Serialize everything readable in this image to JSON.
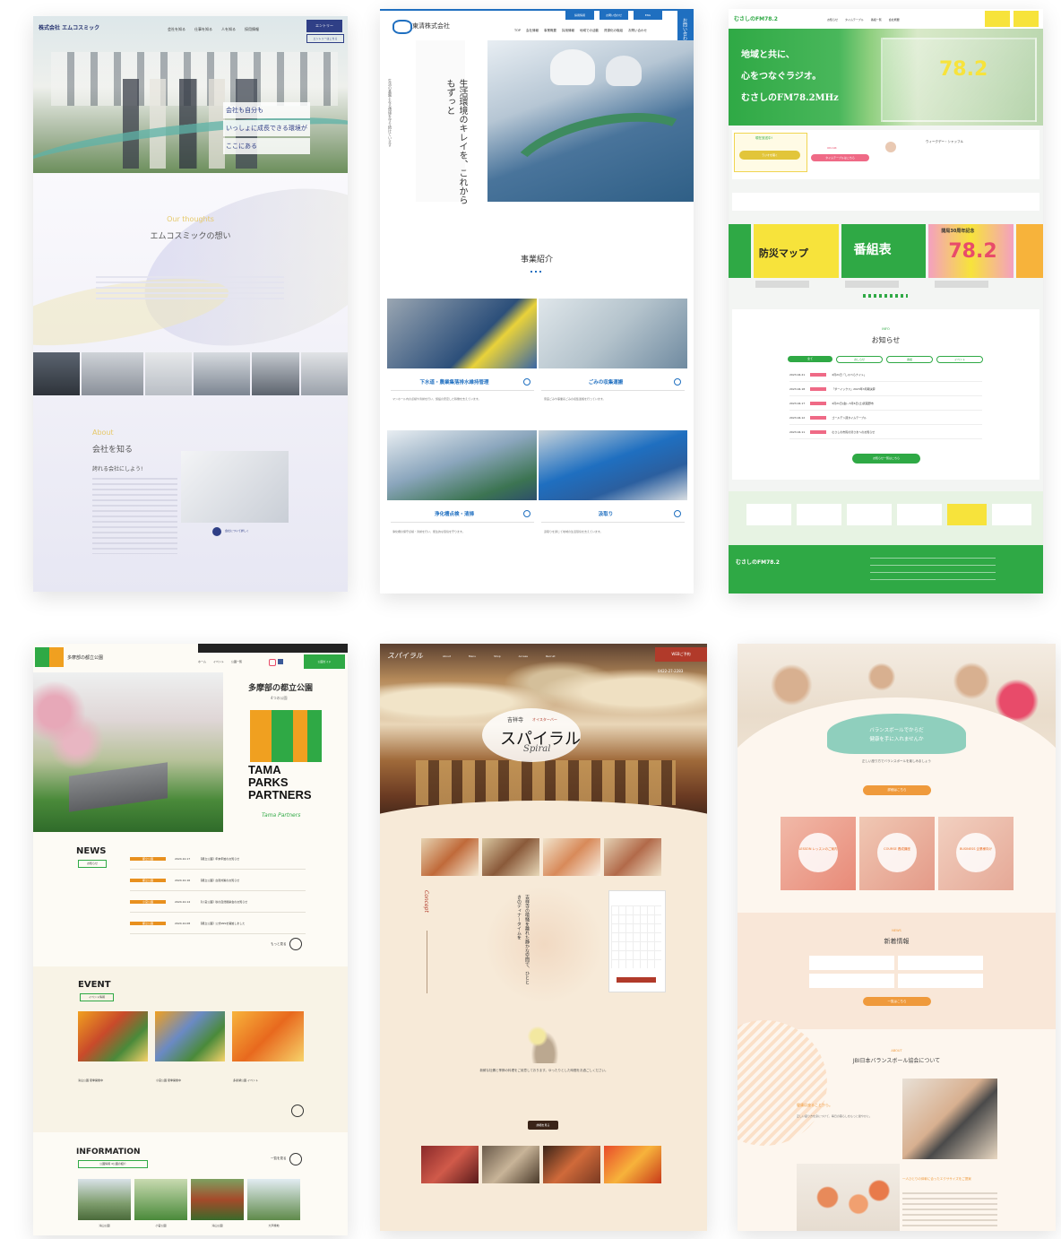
{
  "card1": {
    "logo": "株式会社 エムコスミック",
    "nav": [
      "会社を知る",
      "仕事を知る",
      "人を知る",
      "採用情報"
    ],
    "nav_entry": "エントリー",
    "nav_sub": "エントリーはこちら",
    "hero_lines": [
      "会社も自分も",
      "いっしょに成長できる環境が",
      "ここにある"
    ],
    "section1_en": "Our thoughts",
    "section1_ja": "エムコスミックの想い",
    "section2_en": "About",
    "section2_ja": "会社を知る",
    "section2_sub": "誇れる会社にしよう!",
    "more": "会社について詳しく"
  },
  "card2": {
    "logo": "東清株式会社",
    "nav": [
      "TOP",
      "会社情報",
      "事業概要",
      "採用情報",
      "地域での活動",
      "資源化の取組",
      "お問い合わせ"
    ],
    "top_buttons": [
      "採用情報",
      "お問い合わせ",
      "ENG"
    ],
    "side_tab": "お問い合わせ",
    "hero_vertical": "生活環境のキレイを、これからもずっと",
    "hero_small": "生活の基盤となる環境を守り続けています",
    "section_title": "事業紹介",
    "services": [
      {
        "title": "下水道・農業集落排水維持管理",
        "desc": "マンホール内の点検や清掃を行い、施設の安定した稼働を支えています。"
      },
      {
        "title": "ごみの収集運搬",
        "desc": "家庭ごみや事業系ごみの収集運搬を行っています。"
      },
      {
        "title": "浄化槽点検・清掃",
        "desc": "浄化槽の保守点検・清掃を行い、衛生的な環境を守ります。"
      },
      {
        "title": "汲取り",
        "desc": "汲取りを通じて地域の生活環境を支えています。"
      }
    ]
  },
  "card3": {
    "logo": "むさしのFM78.2",
    "hero_lines": [
      "地域と共に、",
      "心をつなぐラジオ。",
      "むさしのFM78.2MHz"
    ],
    "nav": [
      "お知らせ",
      "タイムテーブル",
      "番組一覧",
      "会社概要"
    ],
    "onair_label": "現在放送中!",
    "onair_btn": "ラジオを聴く",
    "next_label": "ON AIR",
    "next_btn": "タイムテーブルはこちら",
    "dj_label": "ウィークデー・シャッフル",
    "banners": [
      "防災マップ",
      "番組表",
      "開局30周年記念"
    ],
    "info_en": "INFO",
    "info_title": "お知らせ",
    "info_tabs": [
      "全て",
      "おしらせ",
      "番組",
      "イベント"
    ],
    "info_items": [
      {
        "date": "2023.04.21",
        "text": "4月21日「しゃべらナイト」"
      },
      {
        "date": "2023.04.18",
        "text": "「ダーイックス」2023年3月期決算"
      },
      {
        "date": "2023.04.17",
        "text": "4月21日(金)~5月6日(土)武蔵野市"
      },
      {
        "date": "2023.04.12",
        "text": "ゴールデン週タイムテーブル"
      },
      {
        "date": "2023.04.11",
        "text": "むさしの市民の皆さまへのお知らせ"
      }
    ],
    "info_btn": "お知らせ一覧はこちら",
    "footer_logo": "むさしのFM78.2"
  },
  "card4": {
    "logo_text": "多摩部の都立公園",
    "title": "多摩部の都立公園",
    "subtitle": "4つの公園",
    "brand": [
      "TAMA",
      "PARKS",
      "PARTNERS"
    ],
    "brand_script": "Tama Partners",
    "nav": [
      "ホーム",
      "イベント",
      "公園一覧"
    ],
    "cta": "公園ガイド",
    "news_title": "NEWS",
    "news_tag": "お知らせ",
    "news": [
      {
        "tag": "都立公園",
        "date": "2024.10.17",
        "text": "【都立公園】年末年始のお知らせ"
      },
      {
        "tag": "都立公園",
        "date": "2024.10.16",
        "text": "【都立公園】台風対策のお知らせ"
      },
      {
        "tag": "小宮公園",
        "date": "2024.10.14",
        "text": "【小宮公園】秋の自然観察会のお知らせ"
      },
      {
        "tag": "都立公園",
        "date": "2024.10.08",
        "text": "【都立公園】公式SNSを開始しました"
      }
    ],
    "more": "もっと見る",
    "event_title": "EVENT",
    "event_tag": "イベント情報",
    "events": [
      "滝山公園 夏季開催中",
      "小宮公園 夏季開催中",
      "多摩湖公園 イベント"
    ],
    "info_title": "INFORMATION",
    "info_tag": "公園情報 4公園の紹介",
    "parks": [
      "滝山公園",
      "小宮公園",
      "滝山公園",
      "大戸緑地"
    ],
    "list_link": "一覧を見る"
  },
  "card5": {
    "logo": "スパイラル",
    "top_btn": "WEBご予約",
    "tel": "0422-27-2283",
    "nav": [
      "About",
      "Menu",
      "Shop",
      "Access",
      "Recruit"
    ],
    "hero_small": "吉祥寺",
    "hero_tag": "オイスターバー",
    "hero_main": "スパイラル",
    "hero_script": "Spiral",
    "concept_label": "Concept",
    "vertical": "吉祥寺の喧騒を離れた静かな空間で、ひとときのディナータイムを",
    "desc": "新鮮な牡蠣と季節の料理をご用意しております。ゆったりとした時間をお過ごしください。",
    "btn": "詳細を見る"
  },
  "card6": {
    "headline": [
      "バランスボールでからだ",
      "健康を手に入れませんか"
    ],
    "body": "正しい座り方でバランスボールを楽しみましょう",
    "btn": "詳細はこちら",
    "categories": [
      "LESSON レッスンのご案内",
      "COURSE 養成講座",
      "BUSINESS 企業様向け"
    ],
    "news_en": "NEWS",
    "news_title": "新着情報",
    "list_btn": "一覧はこちら",
    "about_en": "ABOUT",
    "about_title": "JBI日本バランスボール協会について",
    "about_heading": "健康は座ることから。",
    "about_body": "正しい座り方を身につけて、毎日の暮らしをもっと健やかに。",
    "bottom_heading": "一人ひとりの体幹に合ったエクササイズをご提案"
  },
  "colors": {
    "card1_accent": "#2f3f86",
    "card2_accent": "#1f6fc0",
    "card3_accent": "#2fa945",
    "card4_accent": "#e8901e",
    "card5_accent": "#b13a2a",
    "card6_accent": "#ef9a3c"
  }
}
